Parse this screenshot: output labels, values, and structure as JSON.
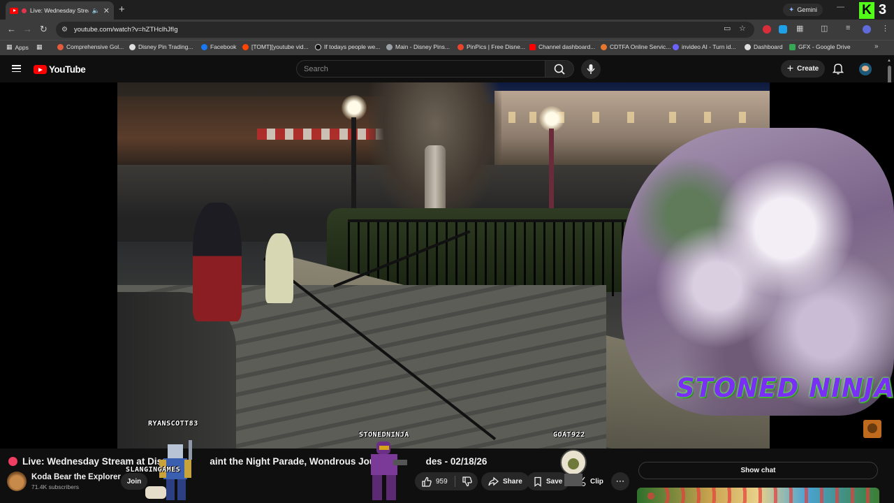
{
  "browser": {
    "tab": {
      "title": "Live: Wednesday Stream at Disn"
    },
    "gemini_label": "Gemini",
    "kick_badge_count": "3",
    "url": "youtube.com/watch?v=hZTHclhJfIg",
    "bookmarks": [
      {
        "label": "Apps",
        "color": "#8ab4f8"
      },
      {
        "label": "Comprehensive Gol...",
        "color": "#e55b3c"
      },
      {
        "label": "Disney Pin Trading...",
        "color": "#e0e0e0"
      },
      {
        "label": "Facebook",
        "color": "#1877f2"
      },
      {
        "label": "[TOMT][youtube vid...",
        "color": "#ff4500"
      },
      {
        "label": "If todays people we...",
        "color": "#111111"
      },
      {
        "label": "Main - Disney Pins...",
        "color": "#9aa0a6"
      },
      {
        "label": "PinPics | Free Disne...",
        "color": "#e8452c"
      },
      {
        "label": "Channel dashboard...",
        "color": "#ff0000"
      },
      {
        "label": "CDTFA Online Servic...",
        "color": "#e8762c"
      },
      {
        "label": "invideo AI - Turn id...",
        "color": "#6c63ff"
      },
      {
        "label": "Dashboard",
        "color": "#e0e0e0"
      },
      {
        "label": "GFX - Google Drive",
        "color": "#34a853"
      }
    ]
  },
  "youtube": {
    "logo_text": "YouTube",
    "search_placeholder": "Search",
    "create_label": "Create"
  },
  "video": {
    "overlay_text": "STONED NINJA",
    "labels": {
      "ryanscott": "RYANSCOTT83",
      "stonedninja": "STONEDNINJA",
      "goat": "GOAT922",
      "slangin": "SLANGINGAMES"
    },
    "title": "Live: Wednesday Stream at Disn",
    "title_tail": "aint the Night Parade, Wondrous Journey",
    "title_end": "des - 02/18/26"
  },
  "channel": {
    "name": "Koda Bear the Explorer",
    "subscribers": "71.4K subscribers",
    "join_label": "Join"
  },
  "actions": {
    "like_count": "959",
    "share_label": "Share",
    "save_label": "Save",
    "clip_label": "Clip"
  },
  "chat": {
    "show_chat_label": "Show chat"
  },
  "colors": {
    "accent_red": "#ff0000",
    "live_dot": "#f03e62",
    "ninja_purple": "#7a2ff5",
    "ninja_glow": "#6bff5b"
  }
}
